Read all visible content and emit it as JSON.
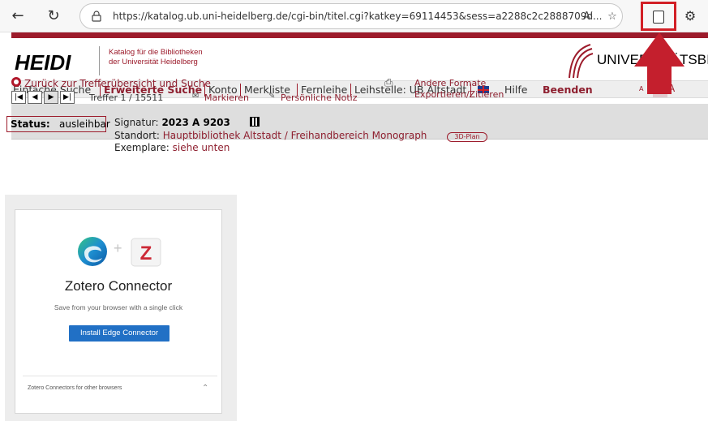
{
  "browser": {
    "back_icon": "back-arrow-icon",
    "reload_icon": "reload-icon",
    "url": "https://katalog.ub.uni-heidelberg.de/cgi-bin/titel.cgi?katkey=69114453&sess=a2288c2c2888709d...",
    "read_aloud_icon": "read-aloud-icon",
    "favorite_icon": "star-icon",
    "zotero_button_icon": "document-icon",
    "extensions_icon": "extensions-icon"
  },
  "header": {
    "logo": "HEIDI",
    "catalog_line1": "Katalog für die Bibliotheken",
    "catalog_line2": "der Universität Heidelberg",
    "uni_name": "UNIVERSITÄTSBIB"
  },
  "navbar": {
    "items": [
      {
        "label": "Einfache Suche"
      },
      {
        "label": "Erweiterte Suche"
      },
      {
        "label": "Konto"
      },
      {
        "label": "Merkliste"
      },
      {
        "label": "Fernleihe"
      },
      {
        "label": "Leihstelle: UB Altstadt"
      }
    ],
    "help": "Hilfe",
    "logout": "Beenden",
    "font_small": "A",
    "font_medium": "A",
    "font_large": "A"
  },
  "infobar": {
    "back_link": "Zurück zur Trefferübersicht und Suche",
    "hits": "Treffer 1 / 15511",
    "mark": "Markieren",
    "note": "Persönliche Notiz",
    "other_formats": "Andere Formate",
    "export": "Exportieren/Zitieren"
  },
  "record": {
    "status_label": "Status:",
    "status_value": "ausleihbar",
    "signature_label": "Signatur:",
    "signature_value": "2023 A 9203",
    "location_label": "Standort:",
    "location_value": "Hauptbibliothek Altstadt / Freihandbereich Monograph",
    "plan": "3D-Plan",
    "copies_label": "Exemplare:",
    "copies_value": "siehe unten"
  },
  "zotero": {
    "title": "Zotero Connector",
    "subtitle": "Save from your browser with a single click",
    "install_button": "Install Edge Connector",
    "other_browsers": "Zotero Connectors for other browsers",
    "browser_logo": "edge-logo-icon",
    "zotero_logo": "zotero-logo-icon"
  },
  "colors": {
    "accent": "#9c1b2b",
    "highlight": "#d21f26",
    "install_button": "#2170c5"
  }
}
